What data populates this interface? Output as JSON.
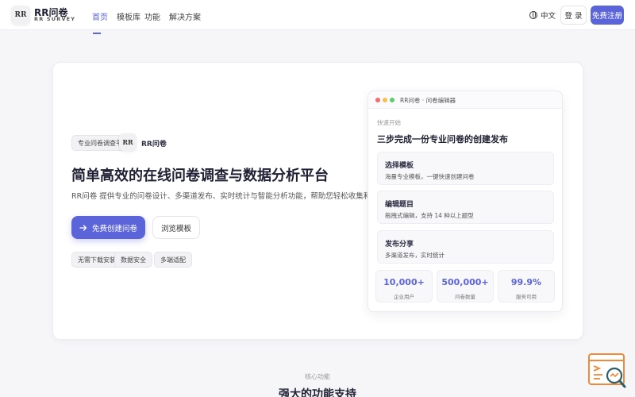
{
  "brand": {
    "name": "RR问卷",
    "subtitle": "RR SURVEY",
    "logo_text": "RR"
  },
  "nav": {
    "items": [
      "首页",
      "模板库",
      "功能",
      "解决方案"
    ],
    "active": 0,
    "language": "中文",
    "login": "登 录",
    "register": "免费注册"
  },
  "hero": {
    "tag": "专业问卷调查平台",
    "mini_brand": "RR问卷",
    "title": "简单高效的在线问卷调查与数据分析平台",
    "description": "RR问卷 提供专业的问卷设计、多渠道发布、实时统计与智能分析功能，帮助您轻松收集和洞察数据，做出更好决策。",
    "primary_button": "免费创建问卷",
    "secondary_button": "浏览模板",
    "features": [
      "无需下载安装",
      "数据安全",
      "多端适配"
    ]
  },
  "preview": {
    "window_title": "RR问卷 · 问卷编辑器",
    "label": "快速开始",
    "heading": "三步完成一份专业问卷的创建发布",
    "items": [
      {
        "title": "选择模板",
        "desc": "海量专业模板，一键快速创建问卷"
      },
      {
        "title": "编辑题目",
        "desc": "拖拽式编辑，支持 14 种以上题型"
      },
      {
        "title": "发布分享",
        "desc": "多渠道发布，实时统计"
      }
    ],
    "stats": [
      {
        "value": "10,000+",
        "label": "企业用户"
      },
      {
        "value": "500,000+",
        "label": "问卷数量"
      },
      {
        "value": "99.9%",
        "label": "服务可用"
      }
    ]
  },
  "section": {
    "label": "核心功能",
    "title": "强大的功能支持"
  },
  "colors": {
    "accent": "#5b64d9",
    "dot_red": "#f26d6d",
    "dot_yellow": "#f5bf4f",
    "dot_green": "#5ccf6d",
    "widget": "#f08a3a"
  },
  "icons": [
    "globe-icon",
    "arrow-right-icon",
    "search-data-icon"
  ]
}
